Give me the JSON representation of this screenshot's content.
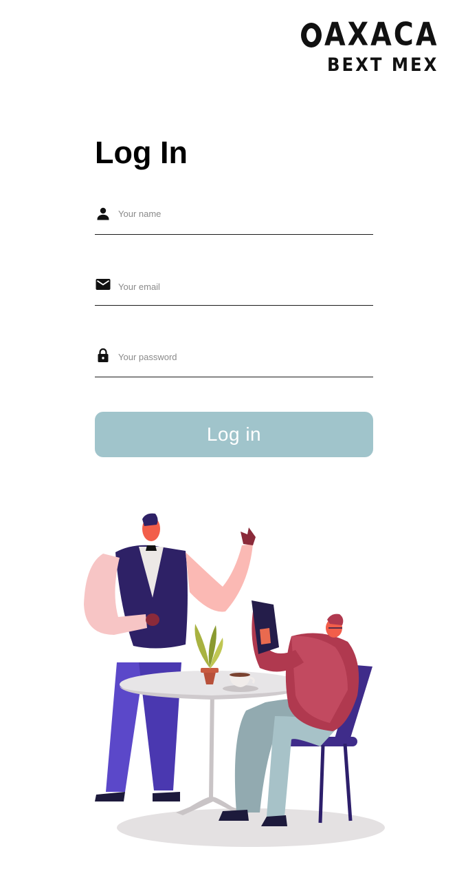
{
  "brand": {
    "name_main": "AXACA",
    "name_sub": "BEXT MEX"
  },
  "login": {
    "title": "Log In",
    "name_placeholder": "Your name",
    "email_placeholder": "Your email",
    "password_placeholder": "Your password",
    "button_label": "Log in"
  },
  "icons": {
    "name": "person-icon",
    "email": "mail-icon",
    "password": "lock-icon"
  },
  "colors": {
    "button": "#a0c4cb",
    "text": "#000000",
    "placeholder": "#8a8a8a"
  }
}
